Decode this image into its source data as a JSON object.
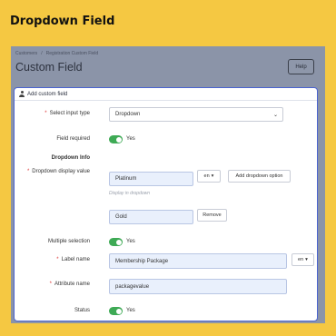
{
  "banner": {
    "title": "Dropdown Field"
  },
  "breadcrumb": {
    "items": [
      "Customers",
      "Registration Custom Field"
    ],
    "separator": "/"
  },
  "page": {
    "title": "Custom Field",
    "help_label": "Help"
  },
  "card": {
    "header": "Add custom field",
    "select_input_type": {
      "label": "Select input type",
      "value": "Dropdown"
    },
    "field_required": {
      "label": "Field required",
      "state": "Yes"
    },
    "dropdown_info": {
      "label": "Dropdown Info"
    },
    "dropdown_display_value": {
      "label": "Dropdown display value",
      "lang": "en",
      "add_option_label": "Add dropdown option",
      "hint": "Display in dropdown",
      "options": [
        {
          "value": "Platinum"
        },
        {
          "value": "Gold",
          "remove_label": "Remove"
        }
      ]
    },
    "multiple_selection": {
      "label": "Multiple selection",
      "state": "Yes"
    },
    "label_name": {
      "label": "Label name",
      "value": "Membership Package",
      "lang": "en"
    },
    "attribute_name": {
      "label": "Attribute name",
      "value": "packagevalue"
    },
    "status": {
      "label": "Status",
      "state": "Yes"
    }
  },
  "colors": {
    "background": "#f5c842",
    "toggle_on": "#3eaa55",
    "card_border": "#4a63d0",
    "required": "#d33333"
  },
  "icons": {
    "header": "user-icon",
    "caret": "caret-down-icon"
  }
}
